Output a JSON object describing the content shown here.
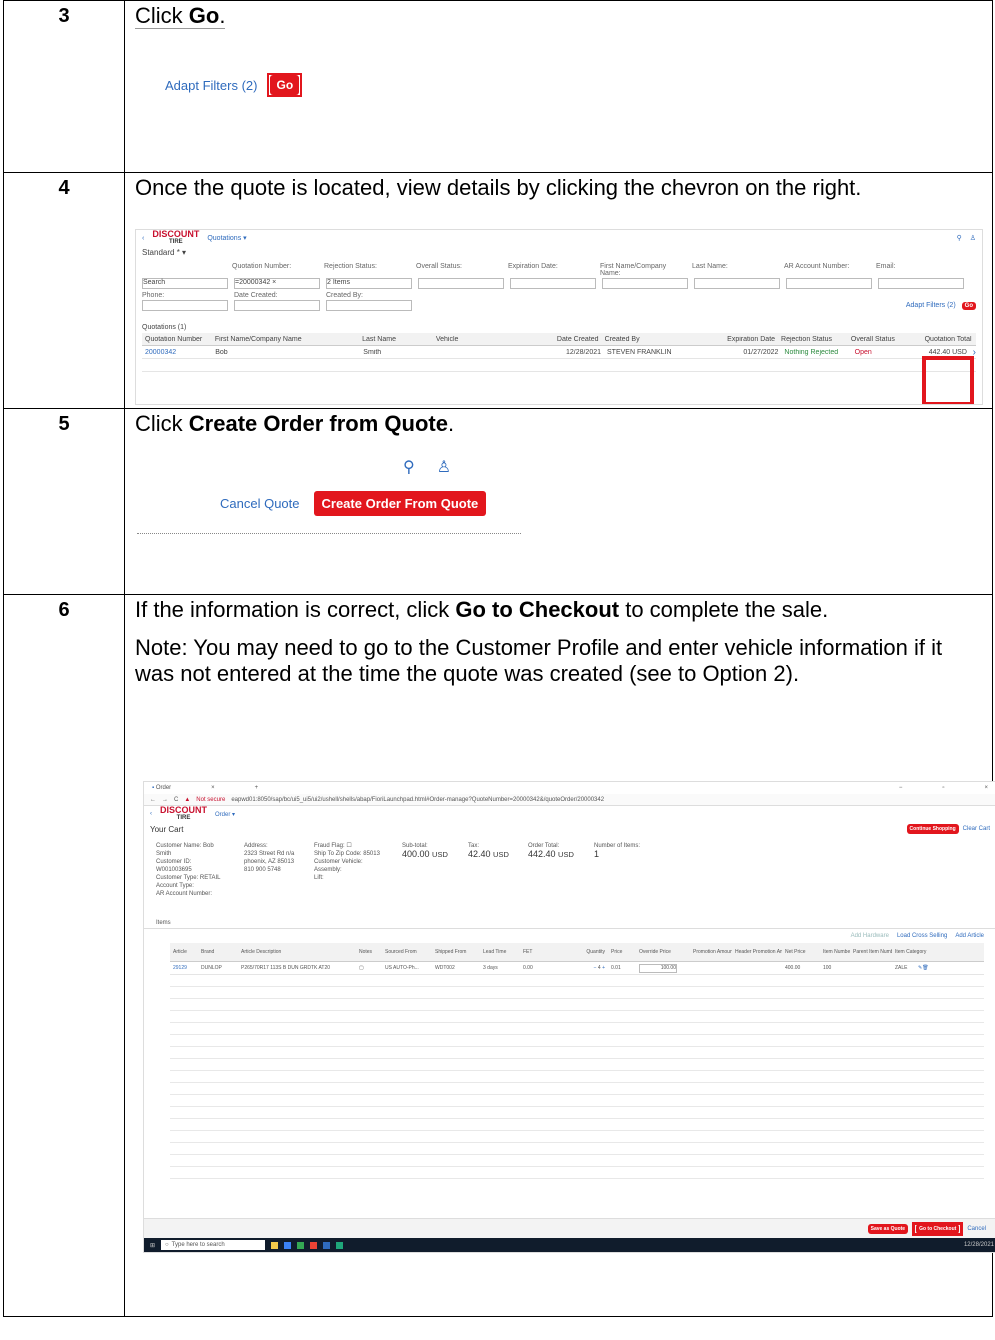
{
  "step3": {
    "number": "3",
    "instr_pre": "Click ",
    "instr_bold": "Go",
    "instr_post": ".",
    "adapt_filters": "Adapt Filters (2)",
    "go_button": "Go"
  },
  "step4": {
    "number": "4",
    "instr": "Once the quote is located, view details by clicking the chevron on the right.",
    "screen": {
      "app_menu": "Quotations ▾",
      "logo_top": "DISCOUNT",
      "logo_bottom": "TIRE",
      "variant": "Standard * ▾",
      "filter_labels": [
        "Quotation Number:",
        "Rejection Status:",
        "Overall Status:",
        "Expiration Date:",
        "First Name/Company Name:",
        "Last Name:",
        "AR Account Number:",
        "Email:"
      ],
      "search_placeholder": "Search",
      "quotation_token": "=20000342 ×",
      "rejection_value": "2 Items",
      "second_labels": [
        "Phone:",
        "Date Created:",
        "Created By:"
      ],
      "adapt_filters": "Adapt Filters (2)",
      "go": "Go",
      "table_title": "Quotations (1)",
      "columns": [
        "Quotation Number",
        "First Name/Company Name",
        "Last Name",
        "Vehicle",
        "Date Created",
        "Created By",
        "Expiration Date",
        "Rejection Status",
        "Overall Status",
        "Quotation Total"
      ],
      "row": [
        "20000342",
        "Bob",
        "Smith",
        "",
        "12/28/2021",
        "STEVEN FRANKLIN",
        "01/27/2022",
        "Nothing Rejected",
        "Open",
        "442.40 USD"
      ]
    }
  },
  "step5": {
    "number": "5",
    "instr_pre": "Click ",
    "instr_bold": "Create Order from Quote",
    "instr_post": ".",
    "cancel_quote": "Cancel Quote",
    "create_order": "Create Order From Quote"
  },
  "step6": {
    "number": "6",
    "instr_pre": "If the information is correct, click ",
    "instr_bold": "Go to Checkout",
    "instr_post": " to complete the sale.",
    "note": "Note: You may need to go to the Customer Profile and enter vehicle information if it was not entered at the time the quote was created (see to Option 2).",
    "browser": {
      "tab_title": "Order",
      "url": "eapwd01:8050/sap/bc/ui5_ui5/ui2/ushell/shells/abap/FioriLaunchpad.html#Order-manage?QuoteNumber=20000342&/quoteOrder/20000342",
      "not_secure": "Not secure",
      "app_menu": "Order ▾",
      "page_title": "Your Cart",
      "continue_shopping": "Continue Shopping",
      "clear_cart": "Clear Cart",
      "customer_name": "Customer Name: Bob Smith",
      "customer_id": "Customer ID: W001003695",
      "customer_type": "Customer Type: RETAIL",
      "account_type": "Account Type:",
      "ar_account": "AR Account Number:",
      "address_label": "Address:",
      "address_lines": "2323 Street Rd n/a phoenix, AZ 85013 810 900 5748",
      "fraud_flag": "Fraud Flag:",
      "ship_to": "Ship To Zip Code: 85013",
      "customer_vehicle": "Customer Vehicle:",
      "assembly": "Assembly:",
      "lift": "Lift:",
      "subtotal_label": "Sub-total:",
      "subtotal": "400.00",
      "tax_label": "Tax:",
      "tax": "42.40",
      "order_total_label": "Order Total:",
      "order_total": "442.40",
      "currency": "USD",
      "items_count_label": "Number of Items:",
      "items_count": "1",
      "items_tab": "Items",
      "add_hardware": "Add Hardware",
      "load_cross_selling": "Load Cross Selling",
      "add_article": "Add Article",
      "columns": [
        "Article",
        "Brand",
        "Article Description",
        "Notes",
        "Sourced From",
        "Shipped From",
        "Lead Time",
        "FET",
        "Quantity",
        "Price",
        "Override Price",
        "Promotion Amount",
        "Header Promotion Amount",
        "Net Price",
        "Item Number",
        "Parent Item Number",
        "Item Category"
      ],
      "row": [
        "29129",
        "DUNLOP",
        "P265/70R17 113S B DUN GRDTK AT20",
        "",
        "US AUTO-Ph...",
        "WDT002",
        "3 days",
        "0.00",
        "4",
        "0.01",
        "100.00",
        "",
        "",
        "400.00",
        "100",
        "",
        "ZALE"
      ],
      "save_as_quote": "Save as Quote",
      "go_to_checkout": "Go to Checkout",
      "cancel": "Cancel",
      "taskbar_search": "Type here to search",
      "clock": "12/28/2021"
    }
  }
}
